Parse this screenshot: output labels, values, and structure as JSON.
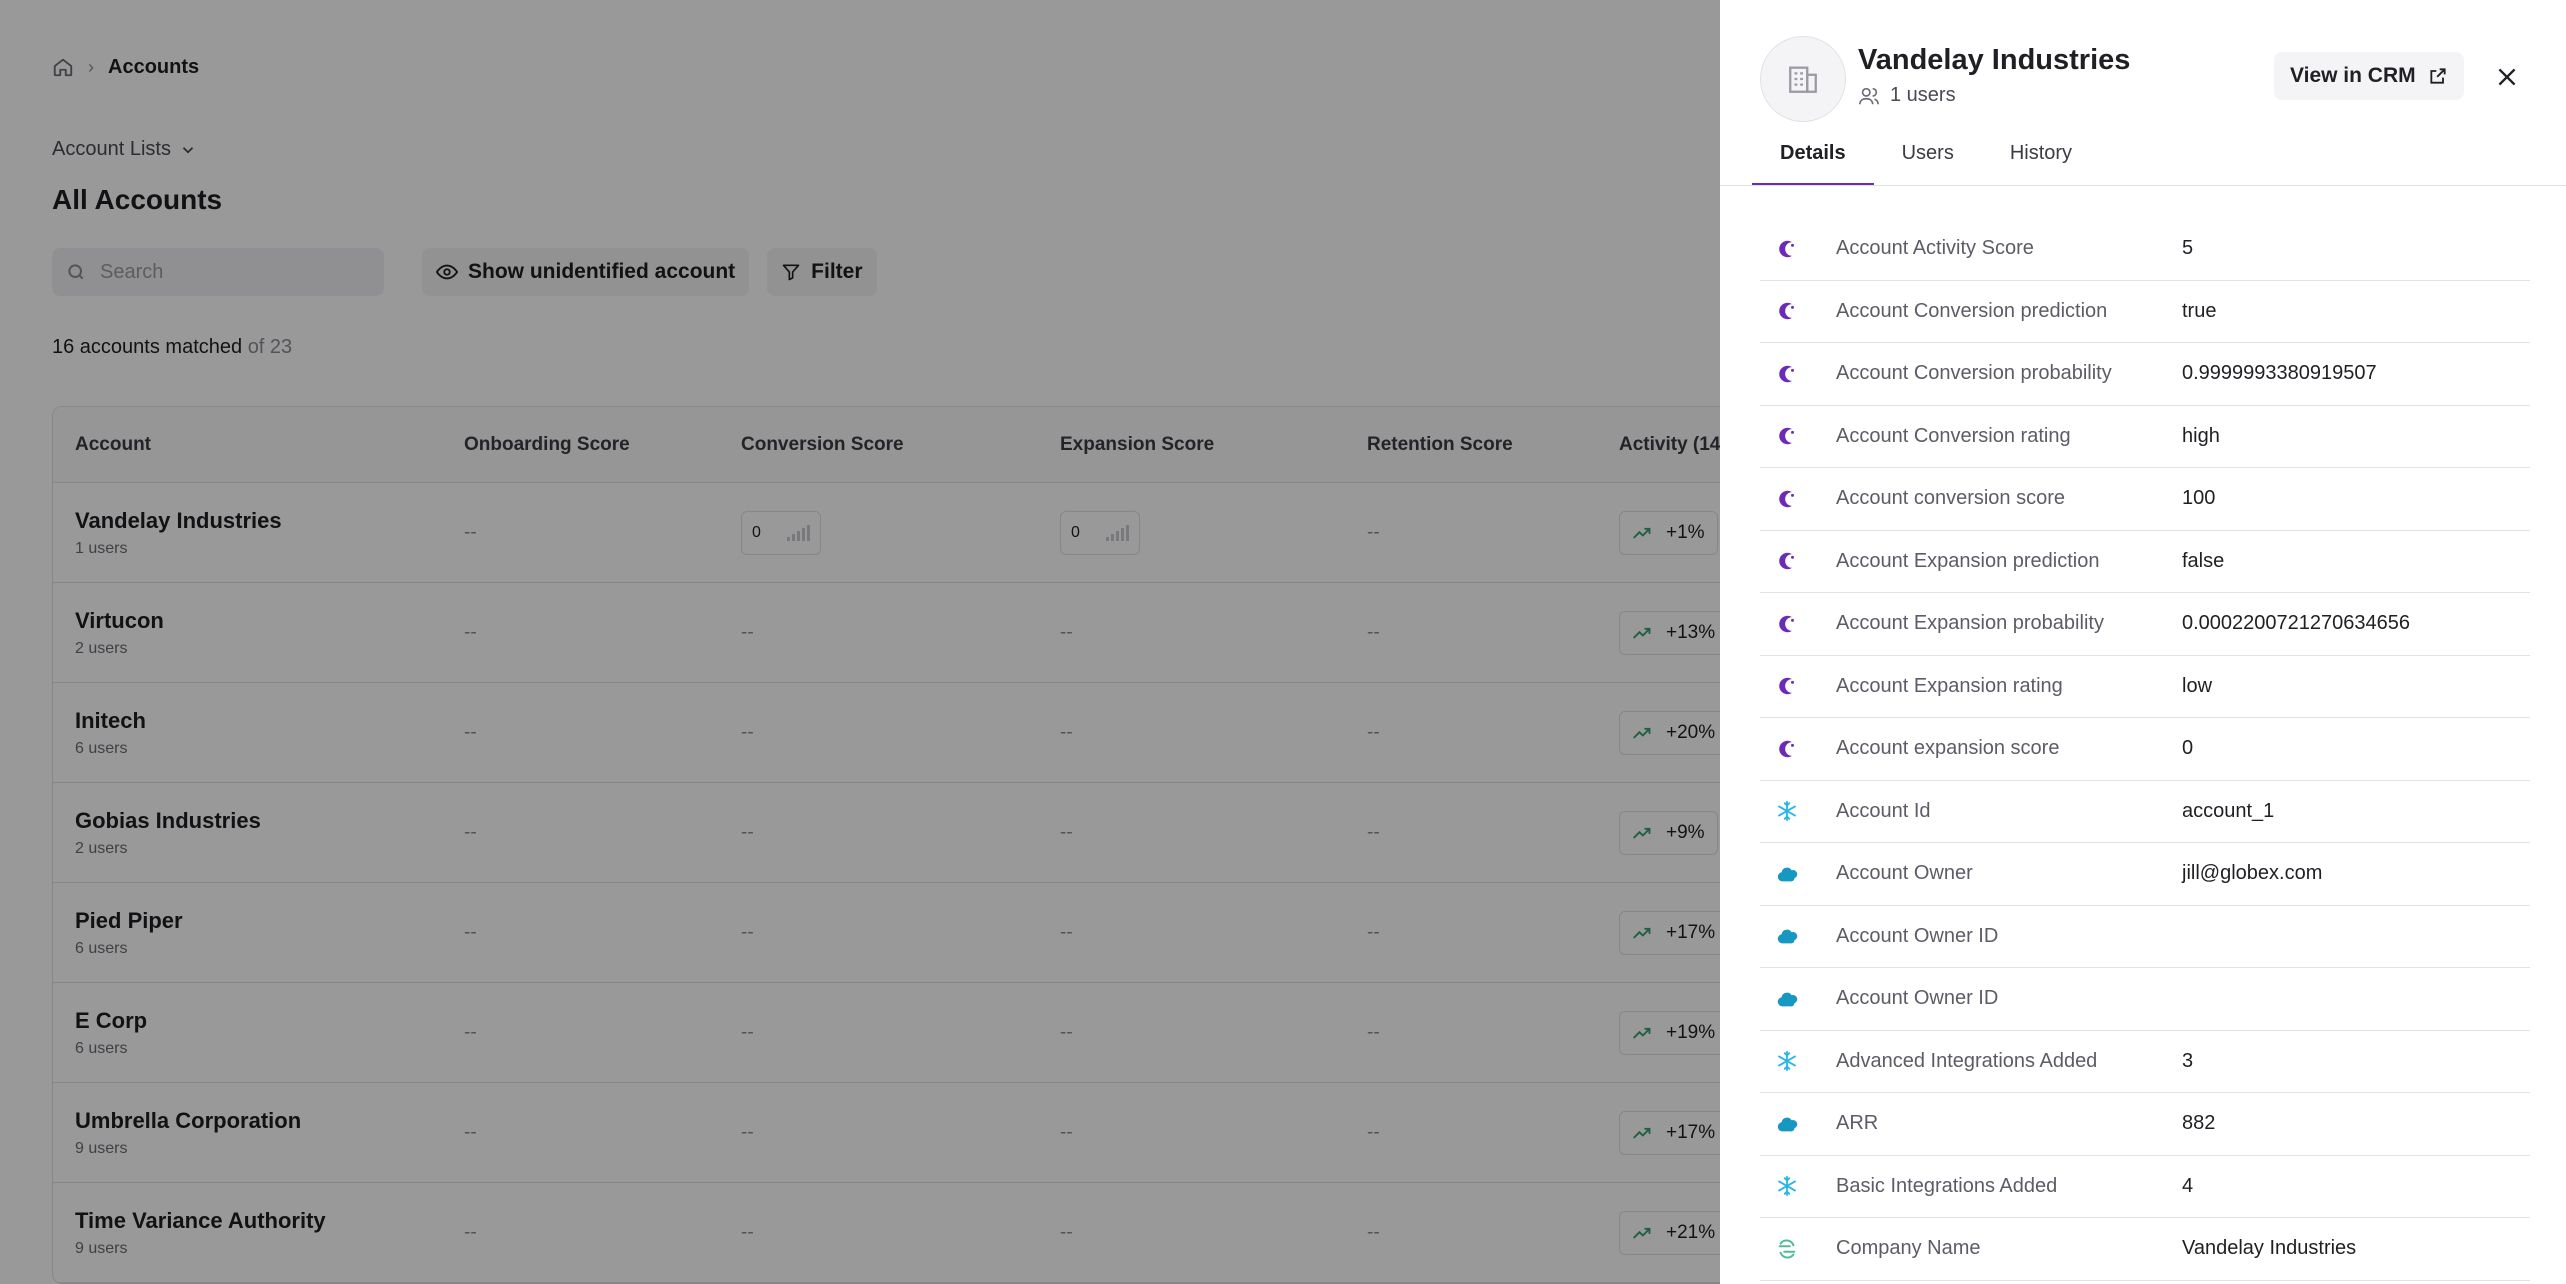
{
  "breadcrumb": {
    "current": "Accounts"
  },
  "lists_link": "Account Lists",
  "page_title": "All Accounts",
  "toolbar": {
    "search_placeholder": "Search",
    "show_unidentified_label": "Show unidentified account",
    "filter_label": "Filter"
  },
  "match": {
    "count_text": "16 accounts matched",
    "total_text": "of 23"
  },
  "table": {
    "columns": [
      "Account",
      "Onboarding Score",
      "Conversion Score",
      "Expansion Score",
      "Retention Score",
      "Activity (14"
    ],
    "rows": [
      {
        "name": "Vandelay Industries",
        "users": "1 users",
        "onboarding": "--",
        "conversion": "0",
        "expansion": "0",
        "retention": "--",
        "activity": "+1%"
      },
      {
        "name": "Virtucon",
        "users": "2 users",
        "onboarding": "--",
        "conversion": "--",
        "expansion": "--",
        "retention": "--",
        "activity": "+13%"
      },
      {
        "name": "Initech",
        "users": "6 users",
        "onboarding": "--",
        "conversion": "--",
        "expansion": "--",
        "retention": "--",
        "activity": "+20%"
      },
      {
        "name": "Gobias Industries",
        "users": "2 users",
        "onboarding": "--",
        "conversion": "--",
        "expansion": "--",
        "retention": "--",
        "activity": "+9%"
      },
      {
        "name": "Pied Piper",
        "users": "6 users",
        "onboarding": "--",
        "conversion": "--",
        "expansion": "--",
        "retention": "--",
        "activity": "+17%"
      },
      {
        "name": "E Corp",
        "users": "6 users",
        "onboarding": "--",
        "conversion": "--",
        "expansion": "--",
        "retention": "--",
        "activity": "+19%"
      },
      {
        "name": "Umbrella Corporation",
        "users": "9 users",
        "onboarding": "--",
        "conversion": "--",
        "expansion": "--",
        "retention": "--",
        "activity": "+17%"
      },
      {
        "name": "Time Variance Authority",
        "users": "9 users",
        "onboarding": "--",
        "conversion": "--",
        "expansion": "--",
        "retention": "--",
        "activity": "+21%"
      }
    ]
  },
  "drawer": {
    "title": "Vandelay Industries",
    "users": "1 users",
    "crm_button_label": "View in CRM",
    "tabs": [
      {
        "label": "Details",
        "active": true
      },
      {
        "label": "Users",
        "active": false
      },
      {
        "label": "History",
        "active": false
      }
    ],
    "properties": [
      {
        "source": "crescent-logo-icon",
        "label": "Account Activity Score",
        "value": "5"
      },
      {
        "source": "crescent-logo-icon",
        "label": "Account Conversion prediction",
        "value": "true"
      },
      {
        "source": "crescent-logo-icon",
        "label": "Account Conversion probability",
        "value": "0.9999993380919507"
      },
      {
        "source": "crescent-logo-icon",
        "label": "Account Conversion rating",
        "value": "high"
      },
      {
        "source": "crescent-logo-icon",
        "label": "Account conversion score",
        "value": "100"
      },
      {
        "source": "crescent-logo-icon",
        "label": "Account Expansion prediction",
        "value": "false"
      },
      {
        "source": "crescent-logo-icon",
        "label": "Account Expansion probability",
        "value": "0.0002200721270634656"
      },
      {
        "source": "crescent-logo-icon",
        "label": "Account Expansion rating",
        "value": "low"
      },
      {
        "source": "crescent-logo-icon",
        "label": "Account expansion score",
        "value": "0"
      },
      {
        "source": "snowflake-icon",
        "label": "Account Id",
        "value": "account_1"
      },
      {
        "source": "cloud-logo-icon",
        "label": "Account Owner",
        "value": "jill@globex.com"
      },
      {
        "source": "cloud-logo-icon",
        "label": "Account Owner ID",
        "value": ""
      },
      {
        "source": "cloud-logo-icon",
        "label": "Account Owner ID",
        "value": ""
      },
      {
        "source": "snowflake-icon",
        "label": "Advanced Integrations Added",
        "value": "3"
      },
      {
        "source": "cloud-logo-icon",
        "label": "ARR",
        "value": "882"
      },
      {
        "source": "snowflake-icon",
        "label": "Basic Integrations Added",
        "value": "4"
      },
      {
        "source": "segment-logo-icon",
        "label": "Company Name",
        "value": "Vandelay Industries"
      }
    ]
  },
  "colors": {
    "accent": "#6b2bb8",
    "crescent": "#6b2bb8",
    "snowflake": "#29b5e8",
    "cloud": "#1798c1",
    "segment": "#52bd94",
    "trend_up": "#2f9e6a"
  }
}
